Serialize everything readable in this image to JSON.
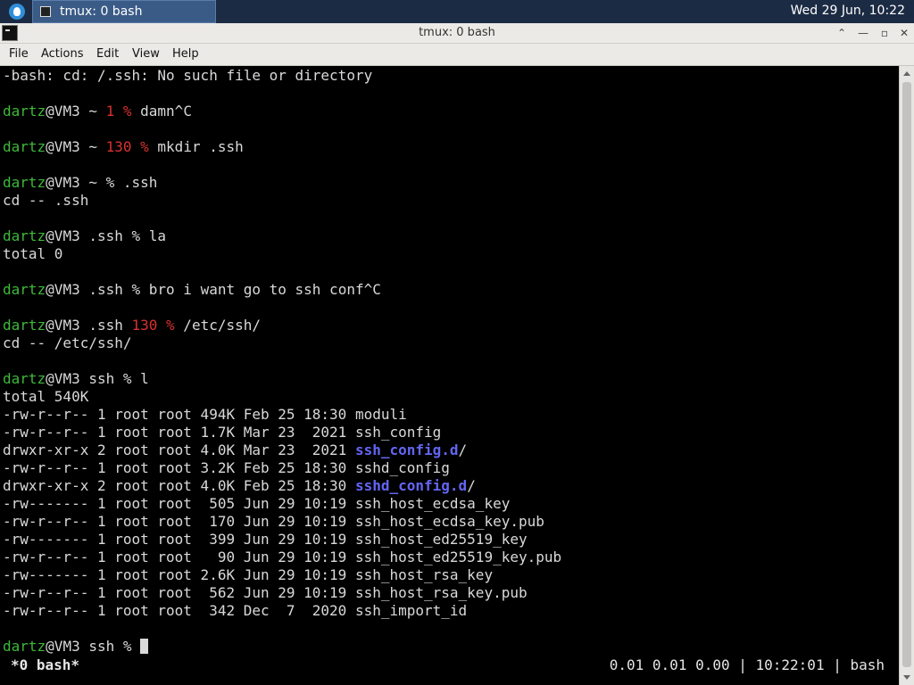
{
  "taskbar": {
    "task_label": "tmux: 0 bash",
    "clock": "Wed 29 Jun, 10:22"
  },
  "window": {
    "title": "tmux: 0 bash",
    "buttons": [
      "⌃",
      "—",
      "▫",
      "✕"
    ]
  },
  "menu": [
    "File",
    "Actions",
    "Edit",
    "View",
    "Help"
  ],
  "terminal": {
    "lines": [
      [
        {
          "t": "-bash: cd: /.ssh: No such file or directory"
        }
      ],
      [],
      [
        {
          "t": "dartz",
          "c": "g"
        },
        {
          "t": "@VM3 ~ "
        },
        {
          "t": "1 %",
          "c": "r"
        },
        {
          "t": " damn^C"
        }
      ],
      [],
      [
        {
          "t": "dartz",
          "c": "g"
        },
        {
          "t": "@VM3 ~ "
        },
        {
          "t": "130 %",
          "c": "r"
        },
        {
          "t": " mkdir .ssh"
        }
      ],
      [],
      [
        {
          "t": "dartz",
          "c": "g"
        },
        {
          "t": "@VM3 ~ % .ssh"
        }
      ],
      [
        {
          "t": "cd -- .ssh"
        }
      ],
      [],
      [
        {
          "t": "dartz",
          "c": "g"
        },
        {
          "t": "@VM3 .ssh % la"
        }
      ],
      [
        {
          "t": "total 0"
        }
      ],
      [],
      [
        {
          "t": "dartz",
          "c": "g"
        },
        {
          "t": "@VM3 .ssh % bro i want go to ssh conf^C"
        }
      ],
      [],
      [
        {
          "t": "dartz",
          "c": "g"
        },
        {
          "t": "@VM3 .ssh "
        },
        {
          "t": "130 %",
          "c": "r"
        },
        {
          "t": " /etc/ssh/"
        }
      ],
      [
        {
          "t": "cd -- /etc/ssh/"
        }
      ],
      [],
      [
        {
          "t": "dartz",
          "c": "g"
        },
        {
          "t": "@VM3 ssh % l"
        }
      ],
      [
        {
          "t": "total 540K"
        }
      ],
      [
        {
          "t": "-rw-r--r-- 1 root root 494K Feb 25 18:30 moduli"
        }
      ],
      [
        {
          "t": "-rw-r--r-- 1 root root 1.7K Mar 23  2021 ssh_config"
        }
      ],
      [
        {
          "t": "drwxr-xr-x 2 root root 4.0K Mar 23  2021 "
        },
        {
          "t": "ssh_config.d",
          "c": "b"
        },
        {
          "t": "/"
        }
      ],
      [
        {
          "t": "-rw-r--r-- 1 root root 3.2K Feb 25 18:30 sshd_config"
        }
      ],
      [
        {
          "t": "drwxr-xr-x 2 root root 4.0K Feb 25 18:30 "
        },
        {
          "t": "sshd_config.d",
          "c": "b"
        },
        {
          "t": "/"
        }
      ],
      [
        {
          "t": "-rw------- 1 root root  505 Jun 29 10:19 ssh_host_ecdsa_key"
        }
      ],
      [
        {
          "t": "-rw-r--r-- 1 root root  170 Jun 29 10:19 ssh_host_ecdsa_key.pub"
        }
      ],
      [
        {
          "t": "-rw------- 1 root root  399 Jun 29 10:19 ssh_host_ed25519_key"
        }
      ],
      [
        {
          "t": "-rw-r--r-- 1 root root   90 Jun 29 10:19 ssh_host_ed25519_key.pub"
        }
      ],
      [
        {
          "t": "-rw------- 1 root root 2.6K Jun 29 10:19 ssh_host_rsa_key"
        }
      ],
      [
        {
          "t": "-rw-r--r-- 1 root root  562 Jun 29 10:19 ssh_host_rsa_key.pub"
        }
      ],
      [
        {
          "t": "-rw-r--r-- 1 root root  342 Dec  7  2020 ssh_import_id"
        }
      ],
      [],
      [
        {
          "t": "dartz",
          "c": "g"
        },
        {
          "t": "@VM3 ssh % "
        },
        {
          "cursor": true
        }
      ]
    ],
    "status_left": "*0 bash*",
    "status_right": "0.01 0.01 0.00 | 10:22:01 | bash"
  },
  "colors": {
    "prompt_user": "#3eb83a",
    "exit_code": "#d8322e",
    "directory": "#6366f4",
    "taskbar": "#1c2b44"
  }
}
